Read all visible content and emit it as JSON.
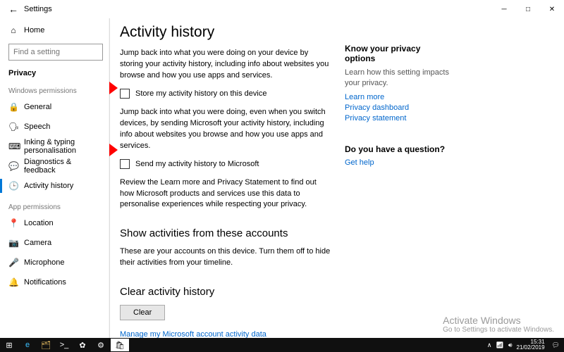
{
  "titlebar": {
    "title": "Settings"
  },
  "sidebar": {
    "home": "Home",
    "searchPlaceholder": "Find a setting",
    "category": "Privacy",
    "group1": "Windows permissions",
    "items1": [
      {
        "icon": "🔒",
        "label": "General"
      },
      {
        "icon": "🗣",
        "label": "Speech"
      },
      {
        "icon": "⌨",
        "label": "Inking & typing personalisation"
      },
      {
        "icon": "💬",
        "label": "Diagnostics & feedback"
      },
      {
        "icon": "🕒",
        "label": "Activity history"
      }
    ],
    "group2": "App permissions",
    "items2": [
      {
        "icon": "📍",
        "label": "Location"
      },
      {
        "icon": "📷",
        "label": "Camera"
      },
      {
        "icon": "🎤",
        "label": "Microphone"
      },
      {
        "icon": "🔔",
        "label": "Notifications"
      }
    ]
  },
  "main": {
    "heading": "Activity history",
    "p1": "Jump back into what you were doing on your device by storing your activity history, including info about websites you browse and how you use apps and services.",
    "chk1": "Store my activity history on this device",
    "p2": "Jump back into what you were doing, even when you switch devices, by sending Microsoft your activity history, including info about websites you browse and how you use apps and services.",
    "chk2": "Send my activity history to Microsoft",
    "p3": "Review the Learn more and Privacy Statement to find out how Microsoft products and services use this data to personalise experiences while respecting your privacy.",
    "h2a": "Show activities from these accounts",
    "p4": "These are your accounts on this device. Turn them off to hide their activities from your timeline.",
    "h2b": "Clear activity history",
    "clear": "Clear",
    "managelink": "Manage my Microsoft account activity data"
  },
  "right": {
    "h1": "Know your privacy options",
    "t1": "Learn how this setting impacts your privacy.",
    "links1": [
      "Learn more",
      "Privacy dashboard",
      "Privacy statement"
    ],
    "h2": "Do you have a question?",
    "links2": [
      "Get help"
    ]
  },
  "watermark": {
    "l1": "Activate Windows",
    "l2": "Go to Settings to activate Windows."
  },
  "taskbar": {
    "time": "15:31",
    "date": "21/02/2019"
  }
}
